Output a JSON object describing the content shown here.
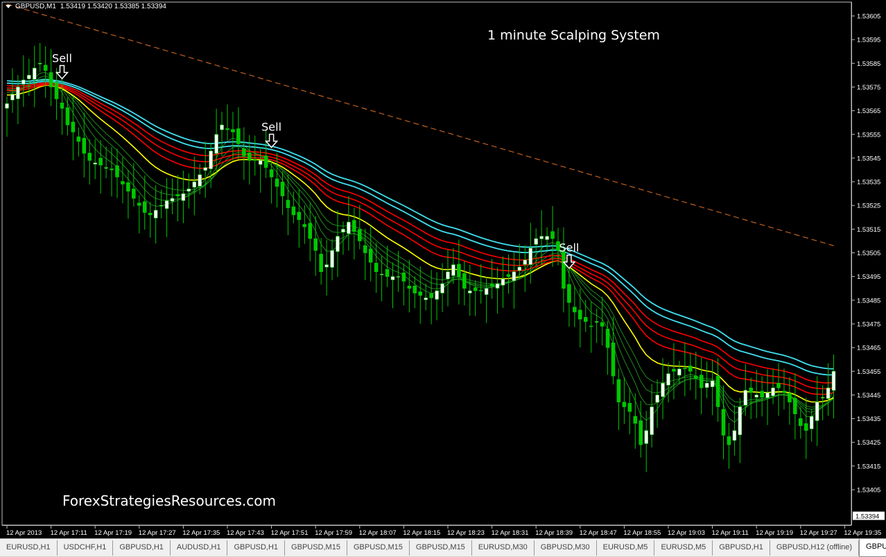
{
  "header": {
    "symbol": "GBPUSD,M1",
    "quote": "1.53419 1.53420 1.53385 1.53394"
  },
  "annotations": {
    "title": "1 minute Scalping System",
    "watermark": "ForexStrategiesResources.com",
    "signal_label": "Sell"
  },
  "colors": {
    "background": "#000000",
    "candle_bull": "#ffffff",
    "candle_bear": "#00c800",
    "fast_ma": "#1e8c1e",
    "yellow_ma": "#ffff00",
    "red_ma": "#ff0000",
    "cyan_ma": "#40e0f0",
    "long_ma": "#c06020"
  },
  "tabs": [
    {
      "label": "EURUSD,H1"
    },
    {
      "label": "USDCHF,H1"
    },
    {
      "label": "GBPUSD,H1"
    },
    {
      "label": "AUDUSD,H1"
    },
    {
      "label": "GBPUSD,H1"
    },
    {
      "label": "GBPUSD,M15"
    },
    {
      "label": "GBPUSD,M15"
    },
    {
      "label": "GBPUSD,M15"
    },
    {
      "label": "EURUSD,M30"
    },
    {
      "label": "GBPUSD,M30"
    },
    {
      "label": "EURUSD,M5"
    },
    {
      "label": "EURUSD,M5"
    },
    {
      "label": "GBPUSD,H1"
    },
    {
      "label": "GBPUSD,H12 (offline)"
    },
    {
      "label": "GBPUSD,",
      "active": true
    }
  ],
  "chart_data": {
    "type": "candlestick",
    "symbol": "GBPUSD",
    "timeframe": "M1",
    "first_bar_time": "12 Apr 2013 17:03",
    "ylim": [
      1.53394,
      1.53612
    ],
    "current_price": "1.53394",
    "y_ticks": [
      "1.53605",
      "1.53595",
      "1.53585",
      "1.53575",
      "1.53565",
      "1.53555",
      "1.53545",
      "1.53535",
      "1.53525",
      "1.53515",
      "1.53505",
      "1.53495",
      "1.53485",
      "1.53475",
      "1.53465",
      "1.53455",
      "1.53445",
      "1.53435",
      "1.53425",
      "1.53415",
      "1.53405"
    ],
    "x_ticks": [
      "12 Apr 2013",
      "12 Apr 17:11",
      "12 Apr 17:19",
      "12 Apr 17:27",
      "12 Apr 17:35",
      "12 Apr 17:43",
      "12 Apr 17:51",
      "12 Apr 17:59",
      "12 Apr 18:07",
      "12 Apr 18:15",
      "12 Apr 18:23",
      "12 Apr 18:31",
      "12 Apr 18:39",
      "12 Apr 18:47",
      "12 Apr 18:55",
      "12 Apr 19:03",
      "12 Apr 19:11",
      "12 Apr 19:19",
      "12 Apr 19:27",
      "12 Apr 19:35"
    ],
    "closes": [
      1.53568,
      1.53572,
      1.53575,
      1.53578,
      1.5358,
      1.53583,
      1.53585,
      1.53582,
      1.53575,
      1.5357,
      1.53566,
      1.53559,
      1.53556,
      1.53552,
      1.53547,
      1.53544,
      1.53543,
      1.53542,
      1.53541,
      1.5354,
      1.53537,
      1.53534,
      1.53531,
      1.53528,
      1.53525,
      1.53522,
      1.53521,
      1.53523,
      1.53525,
      1.53527,
      1.53528,
      1.53529,
      1.5353,
      1.53532,
      1.53535,
      1.53538,
      1.53541,
      1.53548,
      1.53555,
      1.53559,
      1.53557,
      1.53556,
      1.53551,
      1.53546,
      1.53544,
      1.53544,
      1.53544,
      1.53541,
      1.53537,
      1.53533,
      1.53529,
      1.53524,
      1.53521,
      1.53519,
      1.53516,
      1.53511,
      1.53506,
      1.53497,
      1.535,
      1.53506,
      1.53512,
      1.53515,
      1.53518,
      1.53514,
      1.5351,
      1.53505,
      1.53501,
      1.53497,
      1.53496,
      1.53495,
      1.53495,
      1.53495,
      1.53493,
      1.5349,
      1.53488,
      1.53487,
      1.53486,
      1.53486,
      1.53489,
      1.53492,
      1.53497,
      1.535,
      1.53495,
      1.5349,
      1.53489,
      1.53489,
      1.53489,
      1.5349,
      1.53491,
      1.53492,
      1.53494,
      1.53495,
      1.53497,
      1.53499,
      1.53502,
      1.53507,
      1.53511,
      1.53512,
      1.53512,
      1.53511,
      1.53506,
      1.5349,
      1.53484,
      1.5348,
      1.53477,
      1.53476,
      1.53474,
      1.53476,
      1.53474,
      1.53465,
      1.53453,
      1.53442,
      1.5344,
      1.53438,
      1.53433,
      1.53424,
      1.5343,
      1.5344,
      1.53445,
      1.5345,
      1.53454,
      1.53455,
      1.53456,
      1.53456,
      1.53455,
      1.53452,
      1.53448,
      1.5345,
      1.53451,
      1.5344,
      1.53428,
      1.53424,
      1.5343,
      1.5344,
      1.53447,
      1.53446,
      1.53445,
      1.53444,
      1.53446,
      1.53448,
      1.53448,
      1.53446,
      1.53442,
      1.53437,
      1.53432,
      1.5343,
      1.53436,
      1.53442,
      1.53444,
      1.53448,
      1.53455
    ],
    "long_ma": {
      "start_time": "17:03",
      "start_value": 1.5361,
      "end_time": "19:33",
      "end_value": 1.53508,
      "style": "dashed"
    },
    "sell_signals": [
      "17:13",
      "17:51",
      "18:45"
    ]
  }
}
